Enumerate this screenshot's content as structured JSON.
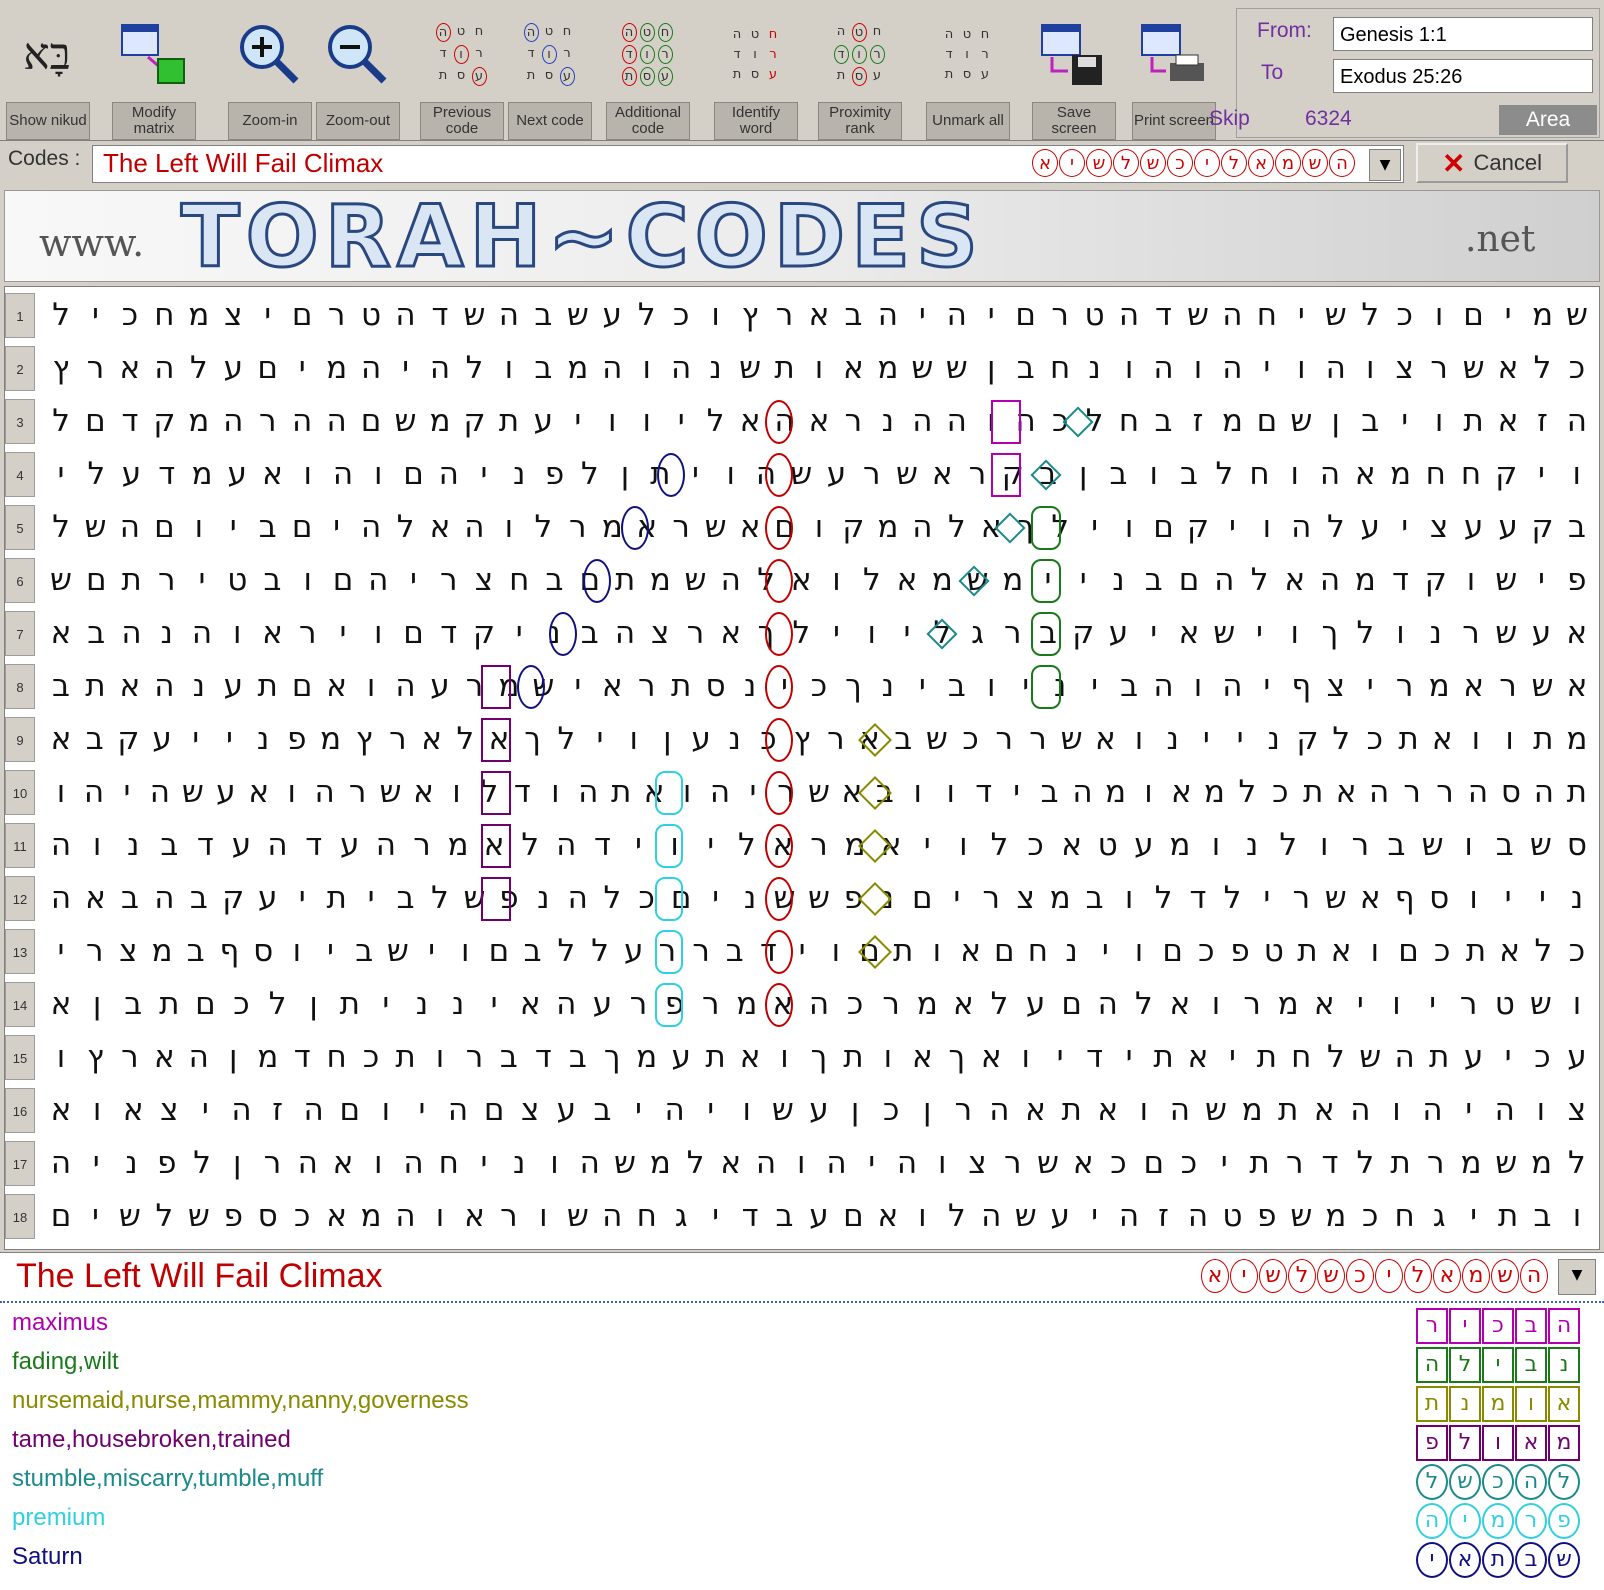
{
  "toolbar": {
    "buttons": [
      {
        "id": "show-nikud",
        "label": "Show nikud",
        "icon": "nikud-letters-icon",
        "glyph": "בָּא"
      },
      {
        "id": "modify-matrix",
        "label": "Modify matrix",
        "icon": "modify-matrix-icon"
      },
      {
        "id": "zoom-in",
        "label": "Zoom-in",
        "icon": "zoom-in-icon"
      },
      {
        "id": "zoom-out",
        "label": "Zoom-out",
        "icon": "zoom-out-icon"
      },
      {
        "id": "previous-code",
        "label": "Previous code",
        "icon": "previous-code-icon"
      },
      {
        "id": "next-code",
        "label": "Next code",
        "icon": "next-code-icon"
      },
      {
        "id": "additional-code",
        "label": "Additional code",
        "icon": "additional-code-icon"
      },
      {
        "id": "identify-word",
        "label": "Identify word",
        "icon": "identify-word-icon"
      },
      {
        "id": "proximity-rank",
        "label": "Proximity rank",
        "icon": "proximity-rank-icon"
      },
      {
        "id": "unmark-all",
        "label": "Unmark all",
        "icon": "unmark-all-icon"
      },
      {
        "id": "save-screen",
        "label": "Save screen",
        "icon": "save-screen-icon"
      },
      {
        "id": "print-screen",
        "label": "Print screen",
        "icon": "print-screen-icon"
      }
    ],
    "mini_letters": [
      "ה",
      "ט",
      "ח",
      "ד",
      "ו",
      "ר",
      "ת",
      "ס",
      "ע"
    ]
  },
  "range": {
    "from_label": "From:",
    "from_value": "Genesis 1:1",
    "to_label": "To",
    "to_value": "Exodus 25:26",
    "skip_label": "Skip",
    "skip_value": "6324",
    "area_label": "Area"
  },
  "codes": {
    "label": "Codes :",
    "selected": "The Left Will Fail Climax",
    "letters": [
      "ה",
      "ש",
      "מ",
      "א",
      "ל",
      "י",
      "כ",
      "ש",
      "ל",
      "ש",
      "י",
      "א"
    ],
    "cancel_label": "Cancel"
  },
  "banner": {
    "prefix": "www.",
    "main": "TORAH~CODES",
    "suffix": ".net"
  },
  "grid": {
    "rows": [
      "שמיםוכלשיחהשדהטרםיהיהבארץוכלעשבהשדהטרםיצמחכיל",
      "כלאשרצוהויהוהונחבןששמאותשנהוהמבולהיהמיםעלהארץ",
      "הזאתויבןשםמזבחלכהוההנראהאליוויעתקמשםההרהמקדםל",
      "ויקחחמאהוחלבובןבקראשרעשהויתןלפניהםוהואעמדעלי",
      "בקעעציעלהויקםוילךאלהמקוםאשראמרלוהאלהיםביוםהשל",
      "פישוקדמהאלהםבניימשמאלואלהשמתםבחצריהםובטירתםש",
      "אעשרנולךוישאיעקברגליוילךארצהבניקדםויראוהנהבא",
      "אשראמריצףיהוהביניובינךכינסתראישמרעהואםתענהאתב",
      "מתוואתכלקניינואשררכשבארץכנעןוילךאלארץמפנייעקבא",
      "תהסהררהאתכלמאומהבידוובאשריהואתהודלואשרהואעשהיהו",
      "סשבושברולנומעטאכלויאמראליוידהלאמרהעדהעדבנוה",
      "נייוסףאשרילדלובמצריםנפששניםכלהנפשלביתיעקבהבאה",
      "כלאתכםואתטפכםוינחםאותםוידבררעללבםוישביוסףבמצרי",
      "ושטריויאמרואלהםעלאמרכהאמרפרעהאינניתןלכםתבןא",
      "עכיעתהשלחתיאתידיואךאותךואתעמךבדברותכחדמןהארץו",
      "צוהיהוהאתמשהואתאהרןכןעשויהיבעצםהיוםהזהיצאוא",
      "למשמרתלדרתיכםכאשרצוהיהוהאלמשהוניחהואהרןלפניה",
      "ובתיגחכמשפטהזהיעשהלואםעבדיגחהשוראוהמאכספשלשים"
    ]
  },
  "results": {
    "title": "The Left Will Fail Climax",
    "letters": [
      "ה",
      "ש",
      "מ",
      "א",
      "ל",
      "י",
      "כ",
      "ש",
      "ל",
      "ש",
      "י",
      "א"
    ],
    "terms": [
      {
        "text": "maximus",
        "color": "#b000b0",
        "letters": [
          "ה",
          "ב",
          "כ",
          "י",
          "ר"
        ]
      },
      {
        "text": "fading,wilt",
        "color": "#1a7a1a",
        "letters": [
          "נ",
          "ב",
          "י",
          "ל",
          "ה"
        ]
      },
      {
        "text": "nursemaid,nurse,mammy,nanny,governess",
        "color": "#8a8a00",
        "letters": [
          "א",
          "ו",
          "מ",
          "נ",
          "ת"
        ]
      },
      {
        "text": "tame,housebroken,trained",
        "color": "#700070",
        "letters": [
          "מ",
          "א",
          "ו",
          "ל",
          "פ"
        ]
      },
      {
        "text": "stumble,miscarry,tumble,muff",
        "color": "#1a8a8a",
        "letters": [
          "ל",
          "ה",
          "כ",
          "ש",
          "ל"
        ]
      },
      {
        "text": "premium",
        "color": "#30d0e0",
        "letters": [
          "פ",
          "ר",
          "מ",
          "י",
          "ה"
        ]
      },
      {
        "text": "Saturn",
        "color": "#101080",
        "letters": [
          "ש",
          "ב",
          "ת",
          "א",
          "י"
        ]
      }
    ]
  },
  "colors": {
    "code_red": "#c00000",
    "term_magenta": "#b000b0",
    "term_green": "#1a7a1a",
    "term_olive": "#8a8a00",
    "term_purple": "#700070",
    "term_teal": "#1a8a8a",
    "term_cyan": "#30d0e0",
    "term_navy": "#101080"
  }
}
